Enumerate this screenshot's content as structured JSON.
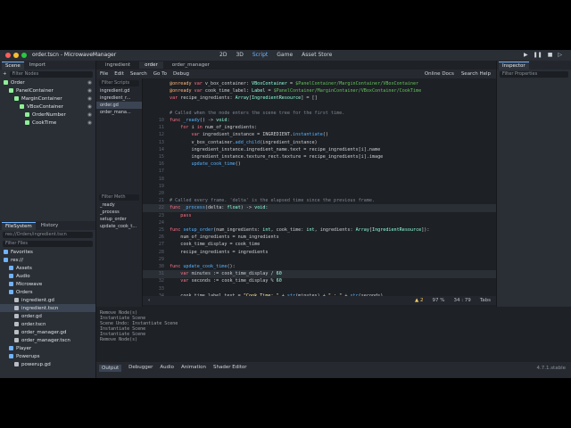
{
  "window": {
    "title": "order.tscn - MicrowaveManager",
    "modes": [
      "2D",
      "3D",
      "Script",
      "Game",
      "Asset Store"
    ],
    "active_mode": "Script"
  },
  "scene_dock": {
    "tabs": [
      "Scene",
      "Import"
    ],
    "filter_placeholder": "Filter Nodes",
    "nodes": [
      {
        "label": "Order",
        "indent": 0,
        "color": "#8eef97"
      },
      {
        "label": "PanelContainer",
        "indent": 1,
        "color": "#8eef97"
      },
      {
        "label": "MarginContainer",
        "indent": 2,
        "color": "#8eef97"
      },
      {
        "label": "VBoxContainer",
        "indent": 3,
        "color": "#8eef97"
      },
      {
        "label": "OrderNumber",
        "indent": 4,
        "color": "#8eef97"
      },
      {
        "label": "CookTime",
        "indent": 4,
        "color": "#8eef97"
      }
    ]
  },
  "filesystem_dock": {
    "tabs": [
      "FileSystem",
      "History"
    ],
    "path": "res://Orders/ingredient.tscn",
    "filter_placeholder": "Filter Files",
    "items": [
      {
        "label": "Favorites",
        "indent": 0,
        "sel": false
      },
      {
        "label": "res://",
        "indent": 0,
        "sel": false
      },
      {
        "label": "Assets",
        "indent": 1,
        "sel": false
      },
      {
        "label": "Audio",
        "indent": 1,
        "sel": false
      },
      {
        "label": "Microwave",
        "indent": 1,
        "sel": false
      },
      {
        "label": "Orders",
        "indent": 1,
        "sel": false
      },
      {
        "label": "ingredient.gd",
        "indent": 2,
        "sel": false
      },
      {
        "label": "ingredient.tscn",
        "indent": 2,
        "sel": true
      },
      {
        "label": "order.gd",
        "indent": 2,
        "sel": false
      },
      {
        "label": "order.tscn",
        "indent": 2,
        "sel": false
      },
      {
        "label": "order_manager.gd",
        "indent": 2,
        "sel": false
      },
      {
        "label": "order_manager.tscn",
        "indent": 2,
        "sel": false
      },
      {
        "label": "Player",
        "indent": 1,
        "sel": false
      },
      {
        "label": "Powerups",
        "indent": 1,
        "sel": false
      },
      {
        "label": "powerup.gd",
        "indent": 2,
        "sel": false
      }
    ]
  },
  "editor_tabs": [
    "ingredient",
    "order",
    "order_manager"
  ],
  "active_editor_tab": "order",
  "script_menu": [
    "File",
    "Edit",
    "Search",
    "Go To",
    "Debug"
  ],
  "script_menu_right": [
    "Online Docs",
    "Search Help"
  ],
  "script_list": {
    "filter_placeholder": "Filter Scripts",
    "items": [
      "ingredient.gd",
      "ingredient_r...",
      "order.gd",
      "order_mana..."
    ],
    "selected": "order.gd",
    "methods_placeholder": "Filter Meth",
    "methods": [
      "_ready",
      "_process",
      "setup_order",
      "update_cook_t..."
    ]
  },
  "code_lines": [
    {
      "n": "",
      "html": "<span class='at'>@onready</span> <span class='kw'>var</span> <span class='tx'>v_box_container: </span><span class='ty'>VBoxContainer</span><span class='tx'> = </span><span class='np'>$PanelContainer/MarginContainer/VBoxContainer</span>"
    },
    {
      "n": "",
      "html": "<span class='at'>@onready</span> <span class='kw'>var</span> <span class='tx'>cook_time_label: </span><span class='ty'>Label</span><span class='tx'> = </span><span class='np'>$PanelContainer/MarginContainer/VBoxContainer/CookTime</span>"
    },
    {
      "n": "",
      "html": "<span class='kw'>var</span> <span class='tx'>recipe_ingredients: </span><span class='ty'>Array</span><span class='tx'>[</span><span class='ty'>IngredientResource</span><span class='tx'>] = []</span>"
    },
    {
      "n": "",
      "html": ""
    },
    {
      "n": "",
      "html": "<span class='cm'># Called when the node enters the scene tree for the first time.</span>"
    },
    {
      "n": "10",
      "html": "<span class='kw'>func</span> <span class='fn'>_ready</span><span class='tx'>() -> </span><span class='ty'>void</span><span class='tx'>:</span>"
    },
    {
      "n": "11",
      "html": "<span class='tx'>    </span><span class='kw'>for</span> <span class='tx'>i </span><span class='kw'>in</span> <span class='tx'>num_of_ingredients:</span>"
    },
    {
      "n": "12",
      "html": "<span class='tx'>        </span><span class='kw'>var</span> <span class='tx'>ingredient_instance = INGREDIENT.</span><span class='fn'>instantiate</span><span class='tx'>()</span>"
    },
    {
      "n": "13",
      "html": "<span class='tx'>        v_box_container.</span><span class='fn'>add_child</span><span class='tx'>(ingredient_instance)</span>"
    },
    {
      "n": "14",
      "html": "<span class='tx'>        ingredient_instance.ingredient_name.text = recipe_ingredients[i].name</span>"
    },
    {
      "n": "15",
      "html": "<span class='tx'>        ingredient_instance.texture_rect.texture = recipe_ingredients[i].image</span>"
    },
    {
      "n": "16",
      "html": "<span class='tx'>        </span><span class='fn'>update_cook_time</span><span class='tx'>()</span>"
    },
    {
      "n": "17",
      "html": ""
    },
    {
      "n": "18",
      "html": ""
    },
    {
      "n": "19",
      "html": ""
    },
    {
      "n": "20",
      "html": ""
    },
    {
      "n": "21",
      "html": "<span class='cm'># Called every frame. 'delta' is the elapsed time since the previous frame.</span>"
    },
    {
      "n": "22",
      "html": "<span class='kw'>func</span> <span class='fn'>_process</span><span class='tx'>(delta: </span><span class='ty'>float</span><span class='tx'>) -> </span><span class='ty'>void</span><span class='tx'>:</span>",
      "hl": true
    },
    {
      "n": "23",
      "html": "<span class='tx'>    </span><span class='kw'>pass</span>"
    },
    {
      "n": "24",
      "html": ""
    },
    {
      "n": "25",
      "html": "<span class='kw'>func</span> <span class='fn'>setup_order</span><span class='tx'>(num_ingredients: </span><span class='ty'>int</span><span class='tx'>, cook_time: </span><span class='ty'>int</span><span class='tx'>, ingredients: </span><span class='ty'>Array</span><span class='tx'>[</span><span class='ty'>IngredientResource</span><span class='tx'>]):</span>"
    },
    {
      "n": "26",
      "html": "<span class='tx'>    num_of_ingredients = num_ingredients</span>"
    },
    {
      "n": "27",
      "html": "<span class='tx'>    cook_time_display = cook_time</span>"
    },
    {
      "n": "28",
      "html": "<span class='tx'>    recipe_ingredients = ingredients</span>"
    },
    {
      "n": "29",
      "html": ""
    },
    {
      "n": "30",
      "html": "<span class='kw'>func</span> <span class='fn'>update_cook_time</span><span class='tx'>():</span>"
    },
    {
      "n": "31",
      "html": "<span class='tx'>    </span><span class='kw'>var</span> <span class='tx'>minutes := cook_time_display / </span><span class='num'>60</span>",
      "hl": true
    },
    {
      "n": "32",
      "html": "<span class='tx'>    </span><span class='kw'>var</span> <span class='tx'>seconds := cook_time_display % </span><span class='num'>60</span>"
    },
    {
      "n": "33",
      "html": ""
    },
    {
      "n": "34",
      "html": "<span class='tx'>    cook_time_label.text = </span><span class='str'>\"Cook Time: \"</span><span class='tx'> + </span><span class='fn'>str</span><span class='tx'>(minutes) + </span><span class='str'>\" : \"</span><span class='tx'> + </span><span class='fn'>str</span><span class='tx'>(seconds)</span>"
    }
  ],
  "status": {
    "warnings": "2",
    "zoom": "97 %",
    "cursor": "34 :   79",
    "indent": "Tabs"
  },
  "inspector": {
    "title": "Inspector",
    "filter_placeholder": "Filter Properties"
  },
  "output_lines": [
    "Remove Node(s)",
    "Instantiate Scene",
    "Scene Undo: Instantiate Scene",
    "Instantiate Scene",
    "Instantiate Scene",
    "Remove Node(s)"
  ],
  "output_filter_placeholder": "Filter Messages",
  "bottom_tabs": [
    "Output",
    "Debugger",
    "Audio",
    "Animation",
    "Shader Editor"
  ],
  "output_counts": [
    "1",
    "0",
    "0",
    "15"
  ],
  "version": "4.7.1.stable"
}
